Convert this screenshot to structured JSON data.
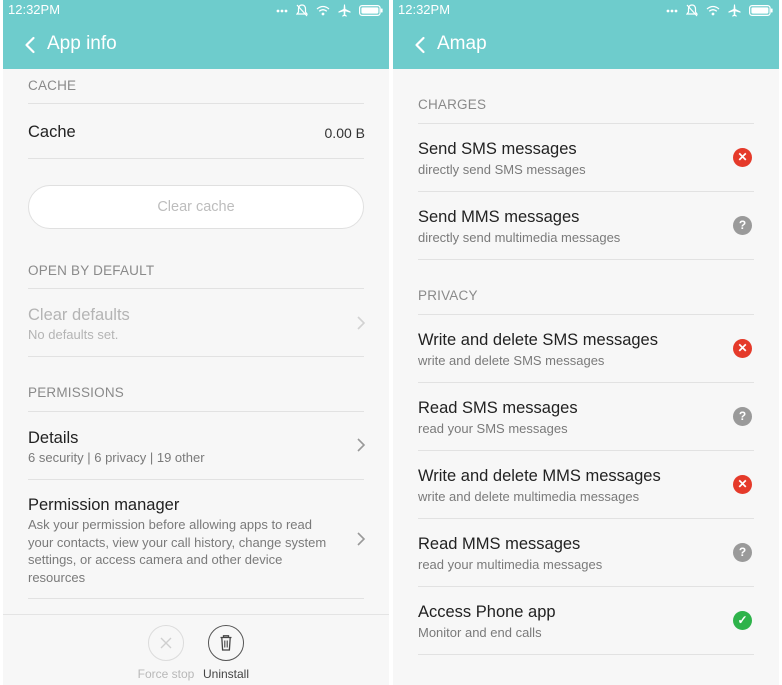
{
  "colors": {
    "accent": "#6ecccc",
    "denied": "#e53a2a",
    "ask": "#9a9a9a",
    "allowed": "#2eb34a"
  },
  "left_screen": {
    "status": {
      "time": "12:32PM"
    },
    "appbar": {
      "title": "App info",
      "back_icon": "chevron-left-icon"
    },
    "cache": {
      "header": "CACHE",
      "label": "Cache",
      "value": "0.00 B",
      "clear_button": "Clear cache"
    },
    "open_by_default": {
      "header": "OPEN BY DEFAULT",
      "title": "Clear defaults",
      "subtitle": "No defaults set."
    },
    "permissions": {
      "header": "PERMISSIONS",
      "details_title": "Details",
      "details_subtitle": "6 security | 6 privacy | 19 other",
      "manager_title": "Permission manager",
      "manager_desc": [
        "Ask your permission before allowing apps to read",
        "your contacts, view your call history, change system",
        "settings, or access camera and other device",
        "resources"
      ]
    },
    "bottom_bar": {
      "force_stop": "Force stop",
      "uninstall": "Uninstall"
    }
  },
  "right_screen": {
    "status": {
      "time": "12:32PM"
    },
    "appbar": {
      "title": "Amap",
      "back_icon": "chevron-left-icon"
    },
    "sections": [
      {
        "header": "CHARGES",
        "items": [
          {
            "title": "Send SMS messages",
            "subtitle": "directly send SMS messages",
            "status": "denied",
            "glyph": "✕"
          },
          {
            "title": "Send MMS messages",
            "subtitle": "directly send multimedia messages",
            "status": "ask",
            "glyph": "?"
          }
        ]
      },
      {
        "header": "PRIVACY",
        "items": [
          {
            "title": "Write and delete SMS messages",
            "subtitle": "write and delete SMS messages",
            "status": "denied",
            "glyph": "✕"
          },
          {
            "title": "Read SMS messages",
            "subtitle": "read your SMS messages",
            "status": "ask",
            "glyph": "?"
          },
          {
            "title": "Write and delete MMS messages",
            "subtitle": "write and delete multimedia messages",
            "status": "denied",
            "glyph": "✕"
          },
          {
            "title": "Read MMS messages",
            "subtitle": "read your multimedia messages",
            "status": "ask",
            "glyph": "?"
          },
          {
            "title": "Access Phone app",
            "subtitle": "Monitor and end calls",
            "status": "allowed",
            "glyph": "✓"
          }
        ]
      }
    ]
  }
}
